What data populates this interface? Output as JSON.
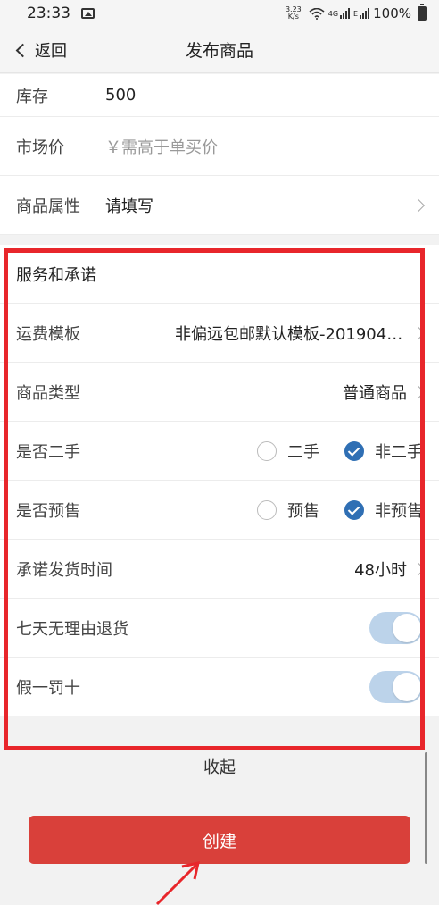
{
  "status_bar": {
    "time": "23:33",
    "net_speed_value": "3.23",
    "net_speed_unit": "K/s",
    "net_type_1": "4G",
    "net_type_2": "E",
    "battery": "100%"
  },
  "nav": {
    "back_label": "返回",
    "title": "发布商品"
  },
  "basic_fields": {
    "stock_label": "库存",
    "stock_value": "500",
    "market_price_label": "市场价",
    "market_price_placeholder": "￥需高于单买价",
    "attributes_label": "商品属性",
    "attributes_value": "请填写"
  },
  "service": {
    "title": "服务和承诺",
    "shipping_template_label": "运费模板",
    "shipping_template_value": "非偏远包邮默认模板-2019041…",
    "product_type_label": "商品类型",
    "product_type_value": "普通商品",
    "second_hand_label": "是否二手",
    "second_hand_options": [
      "二手",
      "非二手"
    ],
    "second_hand_selected": "非二手",
    "presale_label": "是否预售",
    "presale_options": [
      "预售",
      "非预售"
    ],
    "presale_selected": "非预售",
    "delivery_time_label": "承诺发货时间",
    "delivery_time_value": "48小时",
    "seven_day_return_label": "七天无理由退货",
    "seven_day_return_on": true,
    "fake_penalty_label": "假一罚十",
    "fake_penalty_on": true
  },
  "footer": {
    "collapse_label": "收起",
    "create_label": "创建"
  },
  "colors": {
    "accent_red": "#d9403a",
    "highlight_red": "#e8262b",
    "check_blue": "#2f6fb4",
    "toggle_blue": "#bcd3ea"
  }
}
